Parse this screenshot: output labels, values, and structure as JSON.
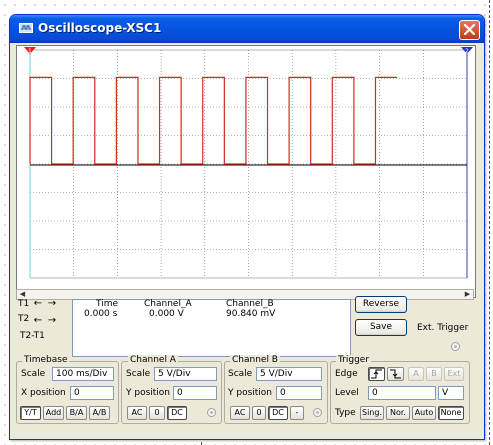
{
  "window": {
    "title": "Oscilloscope-XSC1",
    "close_glyph": "✕"
  },
  "colors": {
    "trace_a": "#d42a1e",
    "trace_b": "#000000",
    "cursor_t1": "#6ed3e3",
    "title_bar": "#0454e0",
    "screen_grid": "#6f6f6f"
  },
  "cursors": {
    "t1_marker": "1",
    "t2_marker": "2"
  },
  "waveform": {
    "channel_a_pulses": 8,
    "channel_a_visible_fraction": 0.84,
    "baseline_level": 0.5,
    "high_level": 0.88
  },
  "readout": {
    "headers": {
      "time": "Time",
      "channel_a": "Channel_A",
      "channel_b": "Channel_B"
    },
    "rows": [
      {
        "label": "T1",
        "time": "0.000 s",
        "channel_a": "0.000 V",
        "channel_b": "90.840 mV"
      },
      {
        "label": "T2",
        "time": "",
        "channel_a": "",
        "channel_b": ""
      }
    ],
    "diff_label": "T2-T1",
    "arrow_left": "←",
    "arrow_right": "→"
  },
  "buttons": {
    "reverse": "Reverse",
    "save": "Save",
    "ext_trigger": "Ext. Trigger"
  },
  "timebase": {
    "title": "Timebase",
    "scale_label": "Scale",
    "scale_value": "100 ms/Div",
    "xpos_label": "X position",
    "xpos_value": "0",
    "modes": [
      "Y/T",
      "Add",
      "B/A",
      "A/B"
    ]
  },
  "channel_a": {
    "title": "Channel A",
    "scale_label": "Scale",
    "scale_value": "5  V/Div",
    "ypos_label": "Y position",
    "ypos_value": "0",
    "coupling": [
      "AC",
      "0",
      "DC"
    ]
  },
  "channel_b": {
    "title": "Channel B",
    "scale_label": "Scale",
    "scale_value": "5  V/Div",
    "ypos_label": "Y position",
    "ypos_value": "0",
    "coupling": [
      "AC",
      "0",
      "DC",
      "-"
    ]
  },
  "trigger": {
    "title": "Trigger",
    "edge_label": "Edge",
    "edge_rising": "ʃ",
    "edge_falling": "Ʒ",
    "sources": [
      "A",
      "B",
      "Ext"
    ],
    "level_label": "Level",
    "level_value": "0",
    "level_unit": "V",
    "type_label": "Type",
    "types": [
      "Sing.",
      "Nor.",
      "Auto",
      "None"
    ]
  }
}
